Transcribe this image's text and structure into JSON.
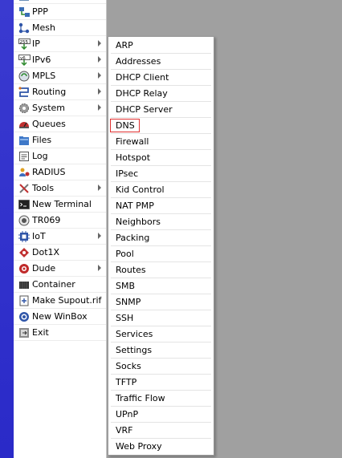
{
  "sidebar": {
    "items": [
      {
        "label": "PPP",
        "icon": "ppp-icon",
        "submenu": false
      },
      {
        "label": "Mesh",
        "icon": "mesh-icon",
        "submenu": false
      },
      {
        "label": "IP",
        "icon": "ip-icon",
        "submenu": true
      },
      {
        "label": "IPv6",
        "icon": "ipv6-icon",
        "submenu": true
      },
      {
        "label": "MPLS",
        "icon": "mpls-icon",
        "submenu": true
      },
      {
        "label": "Routing",
        "icon": "routing-icon",
        "submenu": true
      },
      {
        "label": "System",
        "icon": "gear-icon",
        "submenu": true
      },
      {
        "label": "Queues",
        "icon": "queues-icon",
        "submenu": false
      },
      {
        "label": "Files",
        "icon": "folder-icon",
        "submenu": false
      },
      {
        "label": "Log",
        "icon": "log-icon",
        "submenu": false
      },
      {
        "label": "RADIUS",
        "icon": "radius-icon",
        "submenu": false
      },
      {
        "label": "Tools",
        "icon": "tools-icon",
        "submenu": true
      },
      {
        "label": "New Terminal",
        "icon": "terminal-icon",
        "submenu": false
      },
      {
        "label": "TR069",
        "icon": "tr069-icon",
        "submenu": false
      },
      {
        "label": "IoT",
        "icon": "iot-icon",
        "submenu": true
      },
      {
        "label": "Dot1X",
        "icon": "dot1x-icon",
        "submenu": false
      },
      {
        "label": "Dude",
        "icon": "dude-icon",
        "submenu": true
      },
      {
        "label": "Container",
        "icon": "container-icon",
        "submenu": false
      },
      {
        "label": "Make Supout.rif",
        "icon": "supout-icon",
        "submenu": false
      },
      {
        "label": "New WinBox",
        "icon": "winbox-icon",
        "submenu": false
      },
      {
        "label": "Exit",
        "icon": "exit-icon",
        "submenu": false
      }
    ]
  },
  "ip_submenu": {
    "highlighted": "DNS",
    "items": [
      "ARP",
      "Addresses",
      "DHCP Client",
      "DHCP Relay",
      "DHCP Server",
      "DNS",
      "Firewall",
      "Hotspot",
      "IPsec",
      "Kid Control",
      "NAT PMP",
      "Neighbors",
      "Packing",
      "Pool",
      "Routes",
      "SMB",
      "SNMP",
      "SSH",
      "Services",
      "Settings",
      "Socks",
      "TFTP",
      "Traffic Flow",
      "UPnP",
      "VRF",
      "Web Proxy"
    ]
  },
  "colors": {
    "highlight_border": "#e03030",
    "left_strip": "#2a2ac8",
    "desktop": "#a0a0a0"
  }
}
